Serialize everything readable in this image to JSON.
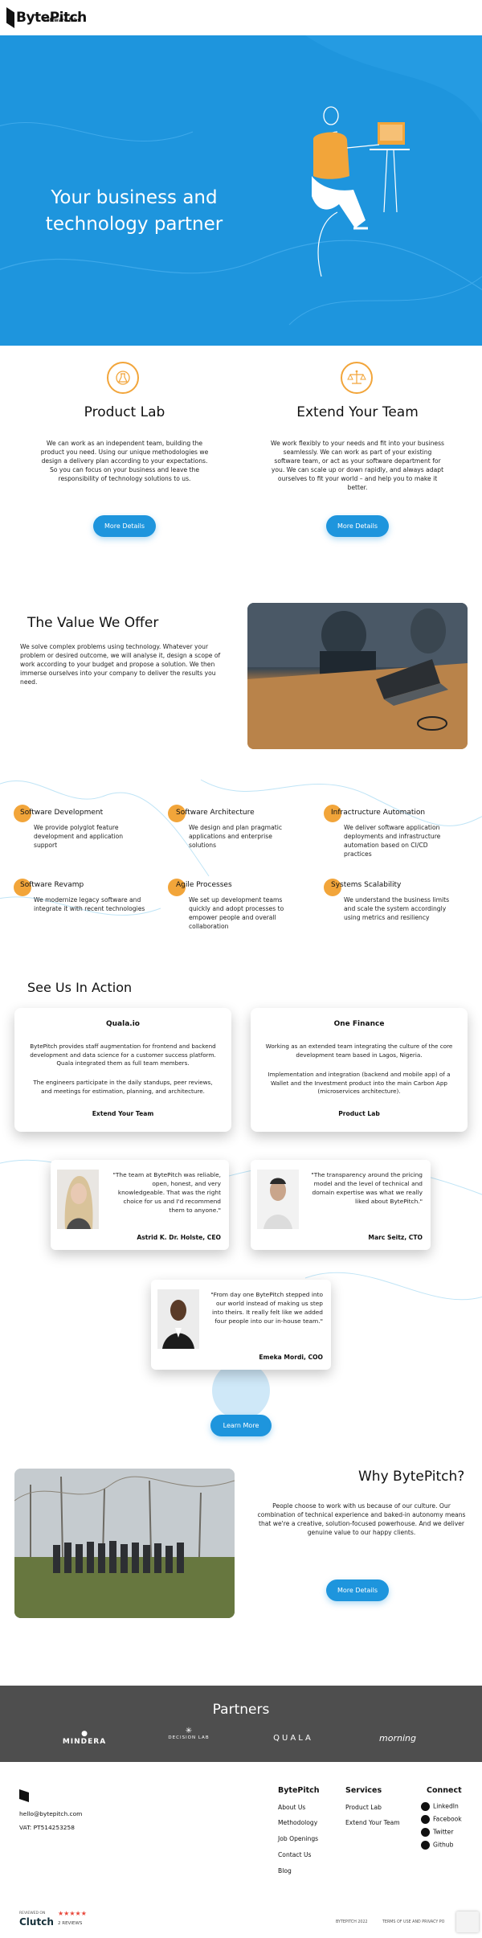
{
  "header": {
    "logo_text": "BytePitch",
    "logo_sub": "software labs"
  },
  "hero": {
    "title": "Your business and technology partner"
  },
  "services": [
    {
      "title": "Product Lab",
      "icon": "lab-flask-icon",
      "text": "We can work as an independent team, building the product you need. Using our unique methodologies we design a delivery plan according to your expectations. So you can focus on your business and leave the responsibility of technology solutions to us.",
      "button": "More Details"
    },
    {
      "title": "Extend Your Team",
      "icon": "balance-scale-icon",
      "text": "We work flexibly to your needs and fit into your business seamlessly. We can work as part of your existing software team, or act as your software department for you. We can scale up or down rapidly, and always adapt ourselves to fit your world – and help you to make it better.",
      "button": "More Details"
    }
  ],
  "value": {
    "title": "The Value We Offer",
    "text": "We solve complex problems using technology. Whatever your problem or desired outcome, we will analyse it, design a scope of work according to your budget and propose a solution. We then immerse ourselves into your company to deliver the results you need."
  },
  "features": [
    {
      "title": "Software Development",
      "text": "We provide polyglot feature development and application support"
    },
    {
      "title": "Software Architecture",
      "text": "We design and plan pragmatic applications and enterprise solutions"
    },
    {
      "title": "Infractructure Automation",
      "text": "We deliver software application deployments and infrastructure automation based on CI/CD practices"
    },
    {
      "title": "Software Revamp",
      "text": "We modernize legacy software and integrate it with recent technologies"
    },
    {
      "title": "Agile Processes",
      "text": "We set up development teams quickly and adopt processes to empower people and overall collaboration"
    },
    {
      "title": "Systems Scalability",
      "text": "We understand the business limits and scale the system accordingly using metrics and resiliency"
    }
  ],
  "action": {
    "title": "See Us In Action",
    "cases": [
      {
        "title": "Quala.io",
        "p1": "BytePitch provides staff augmentation for frontend and backend development and data science for a customer success platform. Quala integrated them as full team members.",
        "p2": "The engineers participate in the daily standups, peer reviews, and meetings for estimation, planning, and architecture.",
        "footer": "Extend Your Team"
      },
      {
        "title": "One Finance",
        "p1": "Working as an extended team integrating the culture of the core development team based in Lagos, Nigeria.",
        "p2": "Implementation and integration (backend and mobile app) of a Wallet and the Investment product into the main Carbon App (microservices architecture).",
        "footer": "Product Lab"
      }
    ],
    "testimonials": [
      {
        "quote": "\"The team at BytePitch was reliable, open, honest, and very knowledgeable. That was the right choice for us and I'd recommend them to anyone.\"",
        "name": "Astrid K. Dr. Holste, CEO"
      },
      {
        "quote": "\"The transparency around the pricing model and the level of technical and domain expertise was what we really liked about BytePitch.\"",
        "name": "Marc Seitz, CTO"
      },
      {
        "quote": "\"From day one BytePitch stepped into our world instead of making us step into theirs. It really felt like we added four people into our in-house team.\"",
        "name": "Emeka Mordi, COO"
      }
    ],
    "button": "Learn More"
  },
  "why": {
    "title": "Why BytePitch?",
    "text": "People choose to work with us because of our culture. Our combination of technical experience and baked-in autonomy means that we're a creative, solution-focused powerhouse. And we deliver genuine value to our happy clients.",
    "button": "More Details"
  },
  "partners": {
    "title": "Partners",
    "logos": [
      "MINDERA",
      "DECISION LAB",
      "QUALA",
      "morning"
    ]
  },
  "footer": {
    "email": "hello@bytepitch.com",
    "vat": "VAT: PT514253258",
    "columns": {
      "bytepitch": {
        "title": "BytePitch",
        "links": [
          "About Us",
          "Methodology",
          "Job Openings",
          "Contact Us",
          "Blog"
        ]
      },
      "services": {
        "title": "Services",
        "links": [
          "Product Lab",
          "Extend Your Team"
        ]
      },
      "connect": {
        "title": "Connect",
        "links": [
          "LinkedIn",
          "Facebook",
          "Twitter",
          "Github"
        ]
      }
    },
    "clutch": {
      "reviewed_on": "REVIEWED ON",
      "brand": "Clutch",
      "reviews": "2 REVIEWS",
      "stars": "★★★★★"
    },
    "copyright": "BYTEPITCH 2022",
    "terms": "TERMS OF USE AND PRIVACY PO"
  },
  "colors": {
    "primary": "#1e95dd",
    "accent": "#f2a53a",
    "partners_bg": "#4e4e4e"
  }
}
